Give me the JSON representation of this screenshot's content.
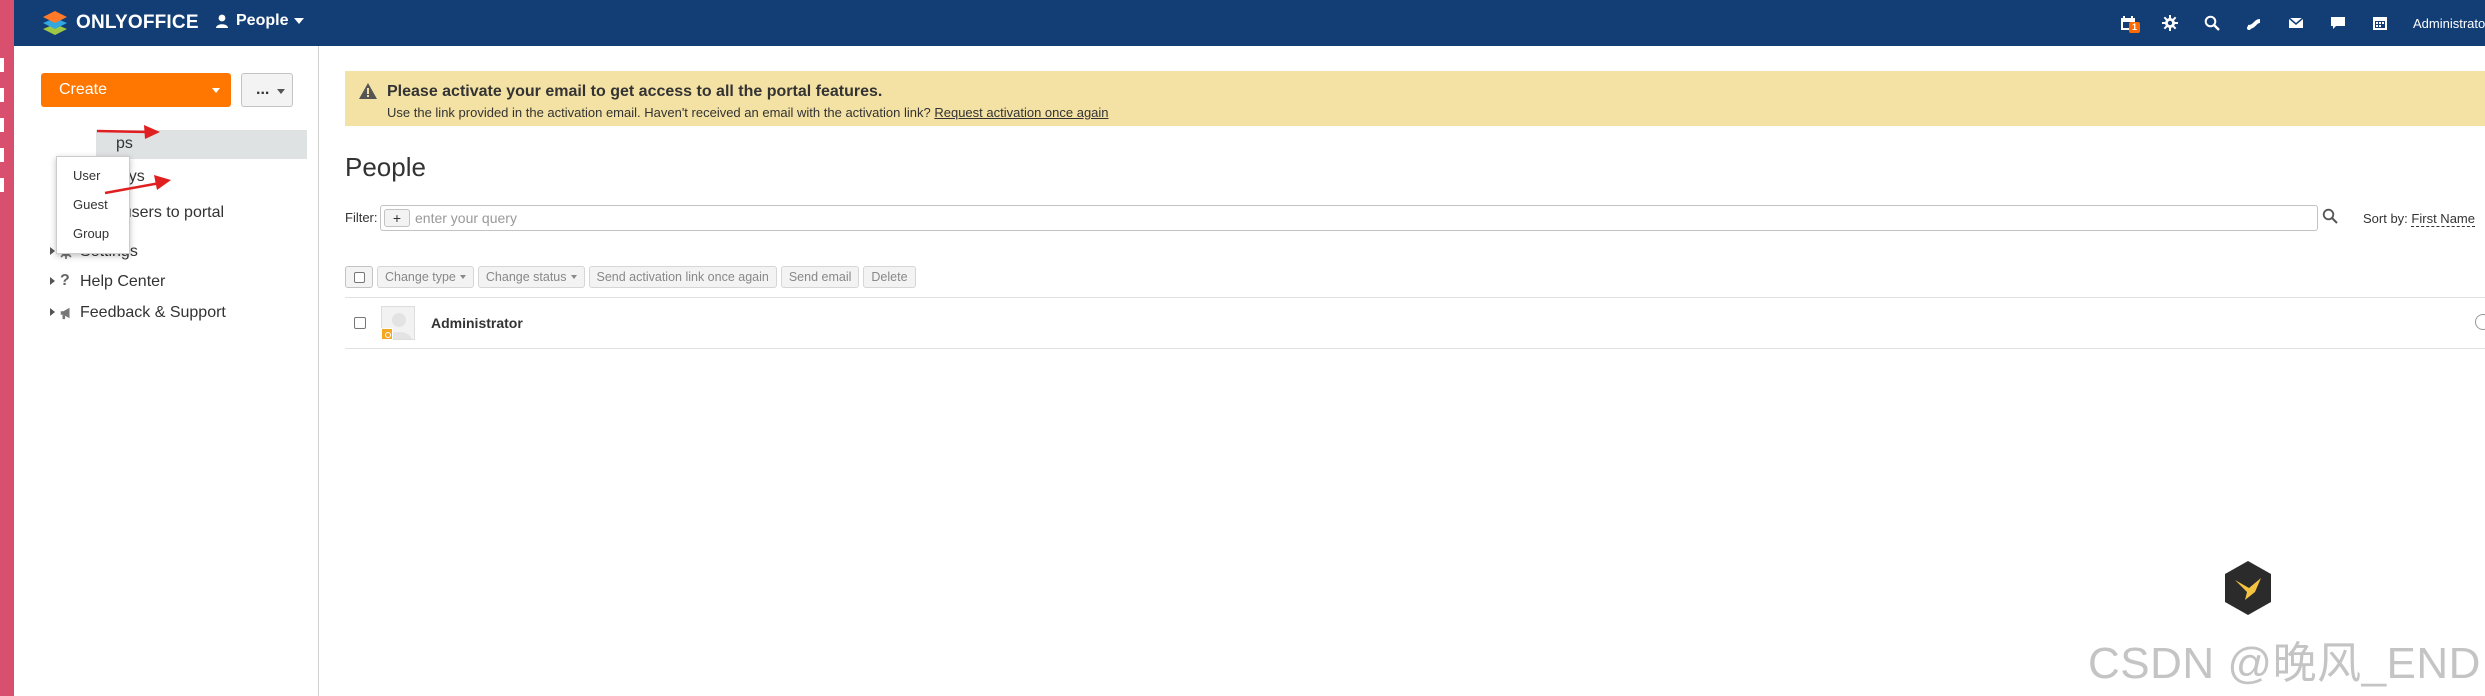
{
  "app": {
    "brand": "ONLYOFFICE",
    "module": "People",
    "user": "Administrator"
  },
  "header": {
    "icons": [
      "calendar-gift-icon",
      "gear-icon",
      "search-icon",
      "feed-icon",
      "mail-icon",
      "chat-icon",
      "calendar-icon"
    ],
    "notification_count": "1"
  },
  "sidebar": {
    "create_label": "Create",
    "more_label": "...",
    "create_menu": [
      "User",
      "Guest",
      "Group"
    ],
    "nav": {
      "groups_partial": "ps",
      "birthdays_partial": "days",
      "invite": "Invite users to portal",
      "settings": "Settings",
      "help": "Help Center",
      "feedback": "Feedback & Support"
    }
  },
  "banner": {
    "title": "Please activate your email to get access to all the portal features.",
    "text": "Use the link provided in the activation email. Haven't received an email with the activation link?",
    "link": "Request activation once again"
  },
  "main": {
    "title": "People",
    "filter_label": "Filter:",
    "filter_plus": "+",
    "filter_placeholder": "enter your query",
    "sort_label": "Sort by:",
    "sort_value": "First Name",
    "actions": [
      "Change type",
      "Change status",
      "Send activation link once again",
      "Send email",
      "Delete"
    ],
    "users": [
      {
        "name": "Administrator",
        "is_admin": true
      }
    ]
  },
  "watermark": "CSDN @晚风_END",
  "colors": {
    "topbar": "#123d75",
    "create": "#ff7700",
    "banner": "#f4e2a4",
    "annotation_arrow": "#e02020",
    "left_edge": "#d8506e"
  }
}
